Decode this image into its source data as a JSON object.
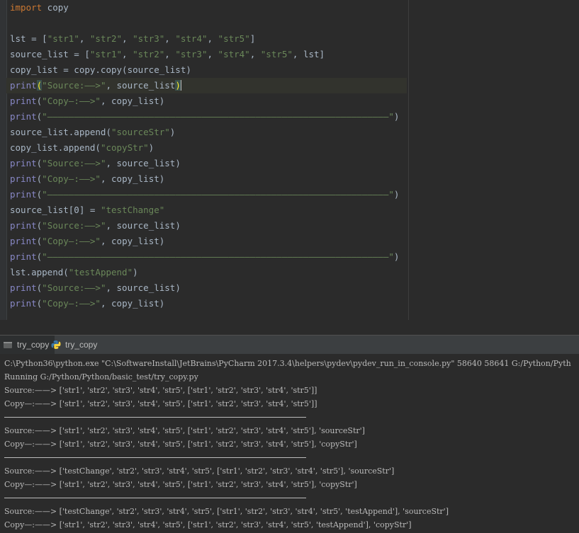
{
  "editor": {
    "code_lines": [
      [
        {
          "t": "kw",
          "v": "import"
        },
        {
          "t": "n",
          "v": " copy"
        }
      ],
      [],
      [
        {
          "t": "n",
          "v": "lst = ["
        },
        {
          "t": "str",
          "v": "\"str1\""
        },
        {
          "t": "n",
          "v": ", "
        },
        {
          "t": "str",
          "v": "\"str2\""
        },
        {
          "t": "n",
          "v": ", "
        },
        {
          "t": "str",
          "v": "\"str3\""
        },
        {
          "t": "n",
          "v": ", "
        },
        {
          "t": "str",
          "v": "\"str4\""
        },
        {
          "t": "n",
          "v": ", "
        },
        {
          "t": "str",
          "v": "\"str5\""
        },
        {
          "t": "n",
          "v": "]"
        }
      ],
      [
        {
          "t": "n",
          "v": "source_list = ["
        },
        {
          "t": "str",
          "v": "\"str1\""
        },
        {
          "t": "n",
          "v": ", "
        },
        {
          "t": "str",
          "v": "\"str2\""
        },
        {
          "t": "n",
          "v": ", "
        },
        {
          "t": "str",
          "v": "\"str3\""
        },
        {
          "t": "n",
          "v": ", "
        },
        {
          "t": "str",
          "v": "\"str4\""
        },
        {
          "t": "n",
          "v": ", "
        },
        {
          "t": "str",
          "v": "\"str5\""
        },
        {
          "t": "n",
          "v": ", lst]"
        }
      ],
      [
        {
          "t": "n",
          "v": "copy_list = copy.copy(source_list)"
        }
      ],
      [
        {
          "t": "bi",
          "v": "print"
        },
        {
          "t": "pm",
          "v": "("
        },
        {
          "t": "str",
          "v": "\"Source:——>\""
        },
        {
          "t": "n",
          "v": ", source_list"
        },
        {
          "t": "pm",
          "v": ")"
        },
        {
          "t": "caret",
          "v": ""
        }
      ],
      [
        {
          "t": "bi",
          "v": "print"
        },
        {
          "t": "n",
          "v": "("
        },
        {
          "t": "str",
          "v": "\"Copy—:——>\""
        },
        {
          "t": "n",
          "v": ", copy_list)"
        }
      ],
      [
        {
          "t": "bi",
          "v": "print"
        },
        {
          "t": "n",
          "v": "("
        },
        {
          "t": "str",
          "v": "\"————————————————————————————————————————————————————————————————\""
        },
        {
          "t": "n",
          "v": ")"
        }
      ],
      [
        {
          "t": "n",
          "v": "source_list.append("
        },
        {
          "t": "str",
          "v": "\"sourceStr\""
        },
        {
          "t": "n",
          "v": ")"
        }
      ],
      [
        {
          "t": "n",
          "v": "copy_list.append("
        },
        {
          "t": "str",
          "v": "\"copyStr\""
        },
        {
          "t": "n",
          "v": ")"
        }
      ],
      [
        {
          "t": "bi",
          "v": "print"
        },
        {
          "t": "n",
          "v": "("
        },
        {
          "t": "str",
          "v": "\"Source:——>\""
        },
        {
          "t": "n",
          "v": ", source_list)"
        }
      ],
      [
        {
          "t": "bi",
          "v": "print"
        },
        {
          "t": "n",
          "v": "("
        },
        {
          "t": "str",
          "v": "\"Copy—:——>\""
        },
        {
          "t": "n",
          "v": ", copy_list)"
        }
      ],
      [
        {
          "t": "bi",
          "v": "print"
        },
        {
          "t": "n",
          "v": "("
        },
        {
          "t": "str",
          "v": "\"————————————————————————————————————————————————————————————————\""
        },
        {
          "t": "n",
          "v": ")"
        }
      ],
      [
        {
          "t": "n",
          "v": "source_list[0] = "
        },
        {
          "t": "str",
          "v": "\"testChange\""
        }
      ],
      [
        {
          "t": "bi",
          "v": "print"
        },
        {
          "t": "n",
          "v": "("
        },
        {
          "t": "str",
          "v": "\"Source:——>\""
        },
        {
          "t": "n",
          "v": ", source_list)"
        }
      ],
      [
        {
          "t": "bi",
          "v": "print"
        },
        {
          "t": "n",
          "v": "("
        },
        {
          "t": "str",
          "v": "\"Copy—:——>\""
        },
        {
          "t": "n",
          "v": ", copy_list)"
        }
      ],
      [
        {
          "t": "bi",
          "v": "print"
        },
        {
          "t": "n",
          "v": "("
        },
        {
          "t": "str",
          "v": "\"————————————————————————————————————————————————————————————————\""
        },
        {
          "t": "n",
          "v": ")"
        }
      ],
      [
        {
          "t": "n",
          "v": "lst.append("
        },
        {
          "t": "str",
          "v": "\"testAppend\""
        },
        {
          "t": "n",
          "v": ")"
        }
      ],
      [
        {
          "t": "bi",
          "v": "print"
        },
        {
          "t": "n",
          "v": "("
        },
        {
          "t": "str",
          "v": "\"Source:——>\""
        },
        {
          "t": "n",
          "v": ", source_list)"
        }
      ],
      [
        {
          "t": "bi",
          "v": "print"
        },
        {
          "t": "n",
          "v": "("
        },
        {
          "t": "str",
          "v": "\"Copy—:——>\""
        },
        {
          "t": "n",
          "v": ", copy_list)"
        }
      ]
    ]
  },
  "run_panel": {
    "tabs": [
      {
        "label": "try_copy",
        "icon": "run-icon",
        "active": true
      },
      {
        "label": "try_copy",
        "icon": "python-icon",
        "active": false
      }
    ],
    "console_lines": [
      {
        "type": "text",
        "text": "C:\\Python36\\python.exe \"C:\\SoftwareInstall\\JetBrains\\PyCharm 2017.3.4\\helpers\\pydev\\pydev_run_in_console.py\" 58640 58641 G:/Python/Pyth"
      },
      {
        "type": "text",
        "text": "Running G:/Python/Python/basic_test/try_copy.py"
      },
      {
        "type": "text",
        "text": "Source:——> ['str1', 'str2', 'str3', 'str4', 'str5', ['str1', 'str2', 'str3', 'str4', 'str5']]"
      },
      {
        "type": "text",
        "text": "Copy—:——> ['str1', 'str2', 'str3', 'str4', 'str5', ['str1', 'str2', 'str3', 'str4', 'str5']]"
      },
      {
        "type": "sep",
        "text": ""
      },
      {
        "type": "text",
        "text": "Source:——> ['str1', 'str2', 'str3', 'str4', 'str5', ['str1', 'str2', 'str3', 'str4', 'str5'], 'sourceStr']"
      },
      {
        "type": "text",
        "text": "Copy—:——> ['str1', 'str2', 'str3', 'str4', 'str5', ['str1', 'str2', 'str3', 'str4', 'str5'], 'copyStr']"
      },
      {
        "type": "sep",
        "text": ""
      },
      {
        "type": "text",
        "text": "Source:——> ['testChange', 'str2', 'str3', 'str4', 'str5', ['str1', 'str2', 'str3', 'str4', 'str5'], 'sourceStr']"
      },
      {
        "type": "text",
        "text": "Copy—:——> ['str1', 'str2', 'str3', 'str4', 'str5', ['str1', 'str2', 'str3', 'str4', 'str5'], 'copyStr']"
      },
      {
        "type": "sep",
        "text": ""
      },
      {
        "type": "text",
        "text": "Source:——> ['testChange', 'str2', 'str3', 'str4', 'str5', ['str1', 'str2', 'str3', 'str4', 'str5', 'testAppend'], 'sourceStr']"
      },
      {
        "type": "text",
        "text": "Copy—:——> ['str1', 'str2', 'str3', 'str4', 'str5', ['str1', 'str2', 'str3', 'str4', 'str5', 'testAppend'], 'copyStr']"
      }
    ]
  },
  "colors": {
    "background": "#2b2b2b",
    "keyword": "#cc7832",
    "string": "#6a8759",
    "builtin": "#8888c6",
    "text": "#a9b7c6",
    "console_text": "#bbbbbb",
    "current_line": "#32332d"
  }
}
